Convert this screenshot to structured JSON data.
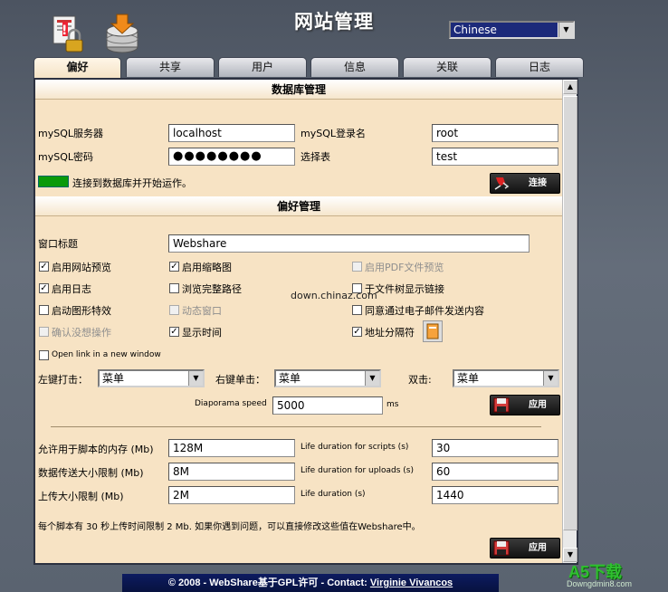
{
  "header": {
    "title": "网站管理",
    "language": "Chinese"
  },
  "tabs": [
    {
      "label": "偏好",
      "active": true
    },
    {
      "label": "共享",
      "active": false
    },
    {
      "label": "用户",
      "active": false
    },
    {
      "label": "信息",
      "active": false
    },
    {
      "label": "关联",
      "active": false
    },
    {
      "label": "日志",
      "active": false
    }
  ],
  "db": {
    "section_title": "数据库管理",
    "server_label": "mySQL服务器",
    "server_value": "localhost",
    "login_label": "mySQL登录名",
    "login_value": "root",
    "password_label": "mySQL密码",
    "password_value": "●●●●●●●●",
    "table_label": "选择表",
    "table_value": "test",
    "status_text": "连接到数据库并开始运作。",
    "connect_label": "连接"
  },
  "prefs": {
    "section_title": "偏好管理",
    "window_title_label": "窗口标题",
    "window_title_value": "Webshare",
    "checks": {
      "site_preview": {
        "label": "启用网站预览",
        "checked": true
      },
      "thumbnails": {
        "label": "启用缩略图",
        "checked": true
      },
      "pdf_preview": {
        "label": "启用PDF文件预览",
        "checked": false
      },
      "log": {
        "label": "启用日志",
        "checked": true
      },
      "full_path": {
        "label": "浏览完整路径",
        "checked": false
      },
      "tree_links": {
        "label": "于文件树显示链接",
        "checked": false
      },
      "graphics": {
        "label": "启动图形特效",
        "checked": false
      },
      "dynamic_window": {
        "label": "动态窗口",
        "checked": false
      },
      "email": {
        "label": "同意通过电子邮件发送内容",
        "checked": false
      },
      "confirm": {
        "label": "确认没想操作",
        "checked": false
      },
      "show_time": {
        "label": "显示时间",
        "checked": true
      },
      "addr_sep": {
        "label": "地址分隔符",
        "checked": true
      },
      "new_window": {
        "label": "Open link in a new window",
        "checked": false
      }
    },
    "watermark_text": "down.chinaz.com",
    "left_click_label": "左键打击：",
    "left_click_value": "菜单",
    "right_click_label": "右键单击：",
    "right_click_value": "菜单",
    "double_click_label": "双击:",
    "double_click_value": "菜单",
    "diaporama_label": "Diaporama speed",
    "diaporama_value": "5000",
    "diaporama_unit": "ms",
    "apply_label": "应用"
  },
  "limits": {
    "memory_label": "允许用于脚本的内存 (Mb)",
    "memory_value": "128M",
    "upload_size_label": "数据传送大小限制 (Mb)",
    "upload_size_value": "8M",
    "upload_max_label": "上传大小限制 (Mb)",
    "upload_max_value": "2M",
    "life_scripts_label": "Life duration for scripts (s)",
    "life_scripts_value": "30",
    "life_uploads_label": "Life duration for uploads (s)",
    "life_uploads_value": "60",
    "life_label": "Life duration (s)",
    "life_value": "1440",
    "note": "每个脚本有 30 秒上传时间限制 2 Mb. 如果你遇到问题，可以直接修改这些值在Webshare中。",
    "apply_label": "应用"
  },
  "footer": {
    "text": "© 2008 - WebShare基于GPL许可  - Contact: ",
    "author": "Virginie Vivancos"
  },
  "site_watermark": {
    "main": "A5下载",
    "sub": "Downgdmin8.com"
  },
  "colors": {
    "panel_bg": "#f7e3c4",
    "status_ok": "#0a9a0a",
    "footer_bg": "#0d1b60"
  }
}
